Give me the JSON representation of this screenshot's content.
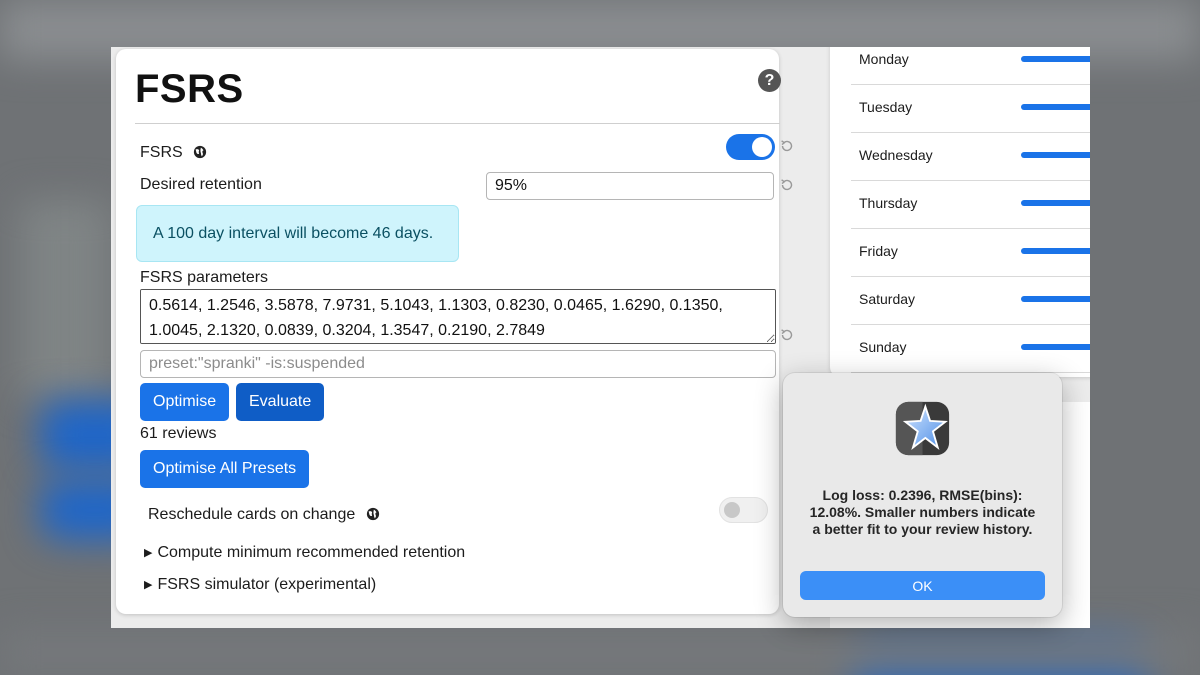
{
  "title": "FSRS",
  "fsrs_toggle": {
    "label": "FSRS",
    "enabled": true
  },
  "desired_retention": {
    "label": "Desired retention",
    "value": "95%"
  },
  "info": "A 100 day interval will become 46 days.",
  "parameters": {
    "label": "FSRS parameters",
    "value": "0.5614, 1.2546, 3.5878, 7.9731, 5.1043, 1.1303, 0.8230, 0.0465, 1.6290, 0.1350, 1.0045, 2.1320, 0.0839, 0.3204, 1.3547, 0.2190, 2.7849"
  },
  "search": {
    "placeholder": "preset:\"spranki\" -is:suspended",
    "value": ""
  },
  "buttons": {
    "optimise": "Optimise",
    "evaluate": "Evaluate",
    "optimise_all": "Optimise All Presets"
  },
  "reviews_count": "61 reviews",
  "reschedule": {
    "label": "Reschedule cards on change",
    "enabled": false
  },
  "collapsibles": [
    "Compute minimum recommended retention",
    "FSRS simulator (experimental)"
  ],
  "weekdays": [
    "Monday",
    "Tuesday",
    "Wednesday",
    "Thursday",
    "Friday",
    "Saturday",
    "Sunday"
  ],
  "dialog": {
    "message": "Log loss: 0.2396, RMSE(bins): 12.08%. Smaller numbers indicate a better fit to your review history.",
    "ok_label": "OK"
  },
  "colors": {
    "accent": "#1a73e8",
    "info_bg": "#cff4fc",
    "dialog_button": "#3b8ff7"
  }
}
